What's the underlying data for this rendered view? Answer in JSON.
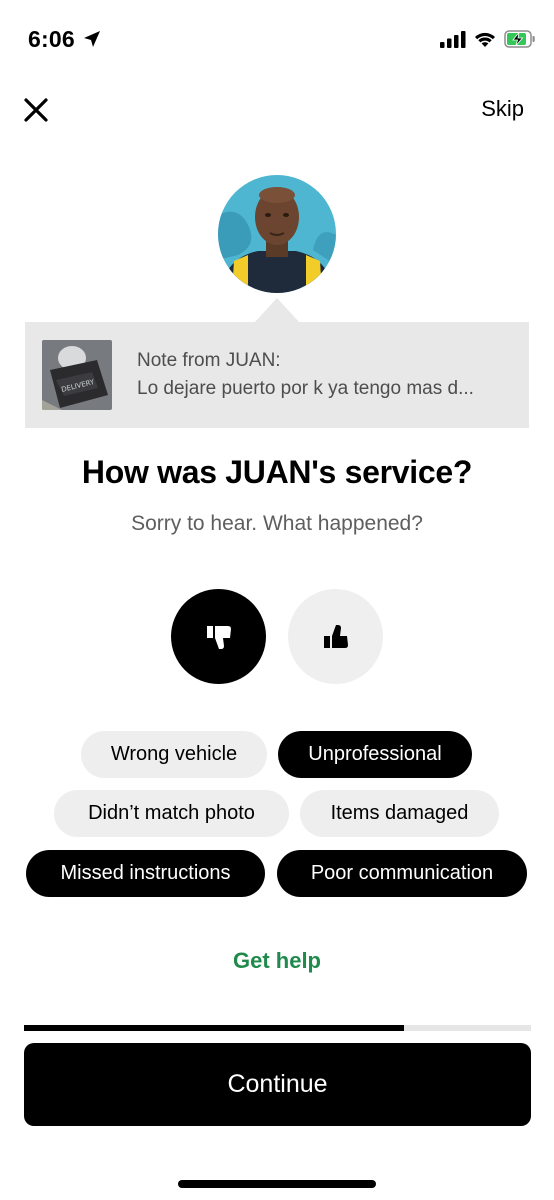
{
  "status_bar": {
    "time": "6:06",
    "icons": [
      "location-arrow-icon",
      "cellular-signal-icon",
      "wifi-icon",
      "battery-charging-icon"
    ]
  },
  "header": {
    "close_icon": "close-icon",
    "skip_label": "Skip"
  },
  "driver": {
    "avatar_icon": "driver-photo"
  },
  "note": {
    "title": "Note from JUAN:",
    "text": "Lo dejare puerto  por k ya tengo mas d..."
  },
  "rating": {
    "question": "How was JUAN's service?",
    "subtitle": "Sorry to hear. What happened?",
    "selected": "thumbs-down",
    "thumb_down_icon": "thumbs-down-icon",
    "thumb_up_icon": "thumbs-up-icon"
  },
  "issues": [
    {
      "label": "Wrong vehicle",
      "selected": false
    },
    {
      "label": "Unprofessional",
      "selected": true
    },
    {
      "label": "Didn’t match photo",
      "selected": false
    },
    {
      "label": "Items damaged",
      "selected": false
    },
    {
      "label": "Missed instructions",
      "selected": true
    },
    {
      "label": "Poor communication",
      "selected": true
    }
  ],
  "get_help_label": "Get help",
  "progress": {
    "fraction": 0.75
  },
  "continue_label": "Continue",
  "colors": {
    "accent_green": "#1f8a4c",
    "primary": "#000000",
    "chip_inactive": "#eeeeee",
    "note_background": "#e8e8e8"
  }
}
